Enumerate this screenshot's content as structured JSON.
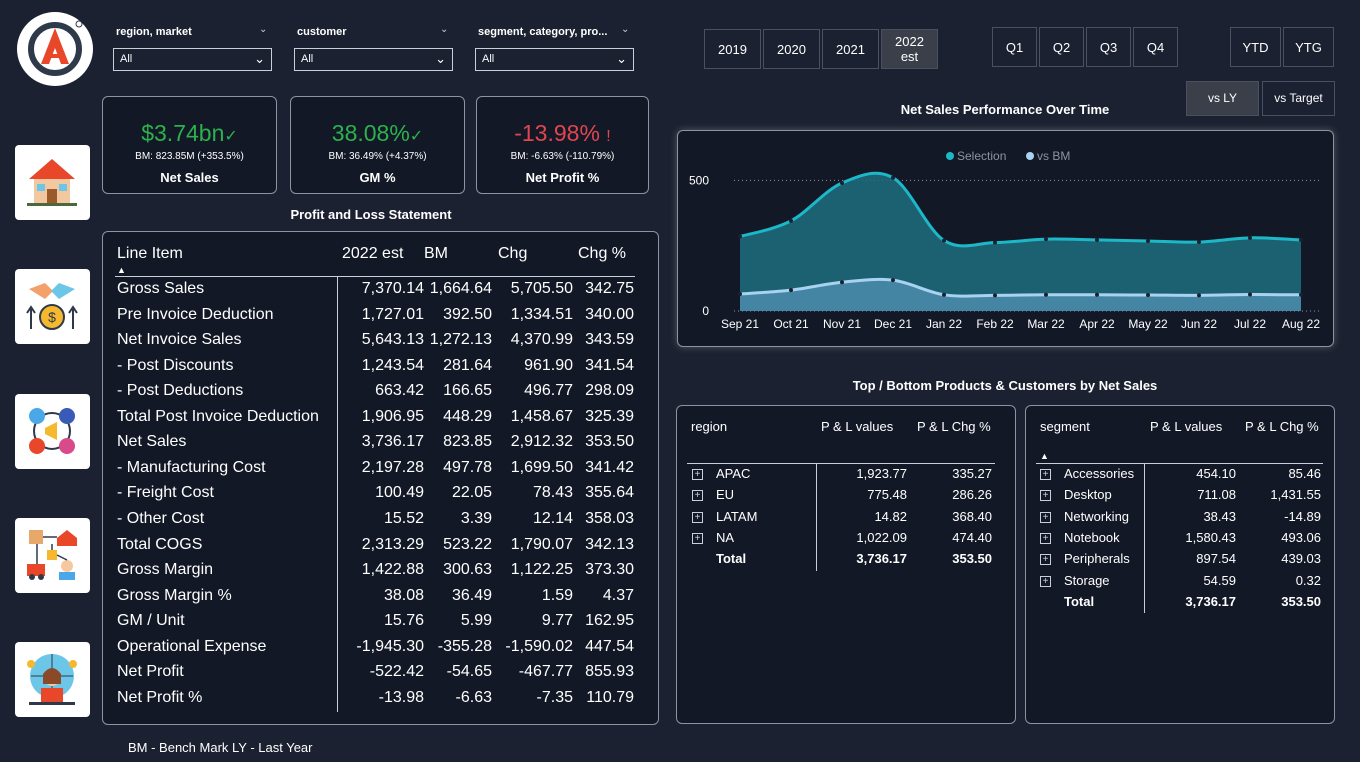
{
  "filters": [
    {
      "label": "region, market",
      "value": "All"
    },
    {
      "label": "customer",
      "value": "All"
    },
    {
      "label": "segment, category, pro...",
      "value": "All"
    }
  ],
  "years": [
    {
      "label": "2019",
      "active": false
    },
    {
      "label": "2020",
      "active": false
    },
    {
      "label": "2021",
      "active": false
    },
    {
      "label": "2022",
      "label2": "est",
      "active": true
    }
  ],
  "quarters": [
    "Q1",
    "Q2",
    "Q3",
    "Q4"
  ],
  "periods": [
    "YTD",
    "YTG"
  ],
  "compare": [
    {
      "label": "vs LY",
      "active": true
    },
    {
      "label": "vs Target",
      "active": false
    }
  ],
  "kpis": [
    {
      "value": "$3.74bn",
      "mark": "✓",
      "bm": "BM: 823.85M (+353.5%)",
      "label": "Net Sales",
      "color": "#2bb24c"
    },
    {
      "value": "38.08%",
      "mark": "✓",
      "bm": "BM: 36.49% (+4.37%)",
      "label": "GM %",
      "color": "#2bb24c"
    },
    {
      "value": "-13.98%",
      "mark": "!",
      "bm": "BM: -6.63% (-110.79%)",
      "label": "Net Profit %",
      "color": "#e0464f"
    }
  ],
  "pl": {
    "title": "Profit and Loss Statement",
    "headers": [
      "Line Item",
      "2022 est",
      "BM",
      "Chg",
      "Chg %"
    ],
    "rows": [
      [
        "Gross Sales",
        "7,370.14",
        "1,664.64",
        "5,705.50",
        "342.75"
      ],
      [
        "Pre Invoice Deduction",
        "1,727.01",
        "392.50",
        "1,334.51",
        "340.00"
      ],
      [
        "Net Invoice Sales",
        "5,643.13",
        "1,272.13",
        "4,370.99",
        "343.59"
      ],
      [
        "- Post Discounts",
        "1,243.54",
        "281.64",
        "961.90",
        "341.54"
      ],
      [
        "- Post Deductions",
        "663.42",
        "166.65",
        "496.77",
        "298.09"
      ],
      [
        "Total Post Invoice Deduction",
        "1,906.95",
        "448.29",
        "1,458.67",
        "325.39"
      ],
      [
        "Net Sales",
        "3,736.17",
        "823.85",
        "2,912.32",
        "353.50"
      ],
      [
        "- Manufacturing Cost",
        "2,197.28",
        "497.78",
        "1,699.50",
        "341.42"
      ],
      [
        "- Freight Cost",
        "100.49",
        "22.05",
        "78.43",
        "355.64"
      ],
      [
        "- Other Cost",
        "15.52",
        "3.39",
        "12.14",
        "358.03"
      ],
      [
        "Total COGS",
        "2,313.29",
        "523.22",
        "1,790.07",
        "342.13"
      ],
      [
        "Gross Margin",
        "1,422.88",
        "300.63",
        "1,122.25",
        "373.30"
      ],
      [
        "Gross Margin %",
        "38.08",
        "36.49",
        "1.59",
        "4.37"
      ],
      [
        "GM / Unit",
        "15.76",
        "5.99",
        "9.77",
        "162.95"
      ],
      [
        "Operational Expense",
        "-1,945.30",
        "-355.28",
        "-1,590.02",
        "447.54"
      ],
      [
        "Net Profit",
        "-522.42",
        "-54.65",
        "-467.77",
        "855.93"
      ],
      [
        "Net Profit %",
        "-13.98",
        "-6.63",
        "-7.35",
        "110.79"
      ]
    ]
  },
  "chart_title": "Net Sales Performance Over Time",
  "chart_data": {
    "type": "area",
    "x": [
      "Sep 21",
      "Oct 21",
      "Nov 21",
      "Dec 21",
      "Jan 22",
      "Feb 22",
      "Mar 22",
      "Apr 22",
      "May 22",
      "Jun 22",
      "Jul 22",
      "Aug 22"
    ],
    "series": [
      {
        "name": "Selection",
        "color": "#1cb8c8",
        "values": [
          285,
          345,
          490,
          510,
          270,
          262,
          275,
          272,
          268,
          264,
          280,
          272
        ]
      },
      {
        "name": "vs BM",
        "color": "#a8d2f0",
        "values": [
          65,
          80,
          110,
          118,
          62,
          60,
          62,
          62,
          61,
          60,
          63,
          62
        ]
      }
    ],
    "yticks": [
      0,
      500
    ],
    "ylim": [
      0,
      620
    ],
    "legend": "top-center",
    "grid": true
  },
  "tb_title": "Top / Bottom Products & Customers by Net Sales",
  "region_table": {
    "headers": [
      "region",
      "P & L values",
      "P & L Chg %"
    ],
    "rows": [
      [
        "APAC",
        "1,923.77",
        "335.27"
      ],
      [
        "EU",
        "775.48",
        "286.26"
      ],
      [
        "LATAM",
        "14.82",
        "368.40"
      ],
      [
        "NA",
        "1,022.09",
        "474.40"
      ]
    ],
    "total": [
      "Total",
      "3,736.17",
      "353.50"
    ]
  },
  "segment_table": {
    "headers": [
      "segment",
      "P & L values",
      "P & L Chg %"
    ],
    "rows": [
      [
        "Accessories",
        "454.10",
        "85.46"
      ],
      [
        "Desktop",
        "711.08",
        "1,431.55"
      ],
      [
        "Networking",
        "38.43",
        "-14.89"
      ],
      [
        "Notebook",
        "1,580.43",
        "493.06"
      ],
      [
        "Peripherals",
        "897.54",
        "439.03"
      ],
      [
        "Storage",
        "54.59",
        "0.32"
      ]
    ],
    "total": [
      "Total",
      "3,736.17",
      "353.50"
    ]
  },
  "footer": "BM - Bench Mark   LY - Last Year"
}
